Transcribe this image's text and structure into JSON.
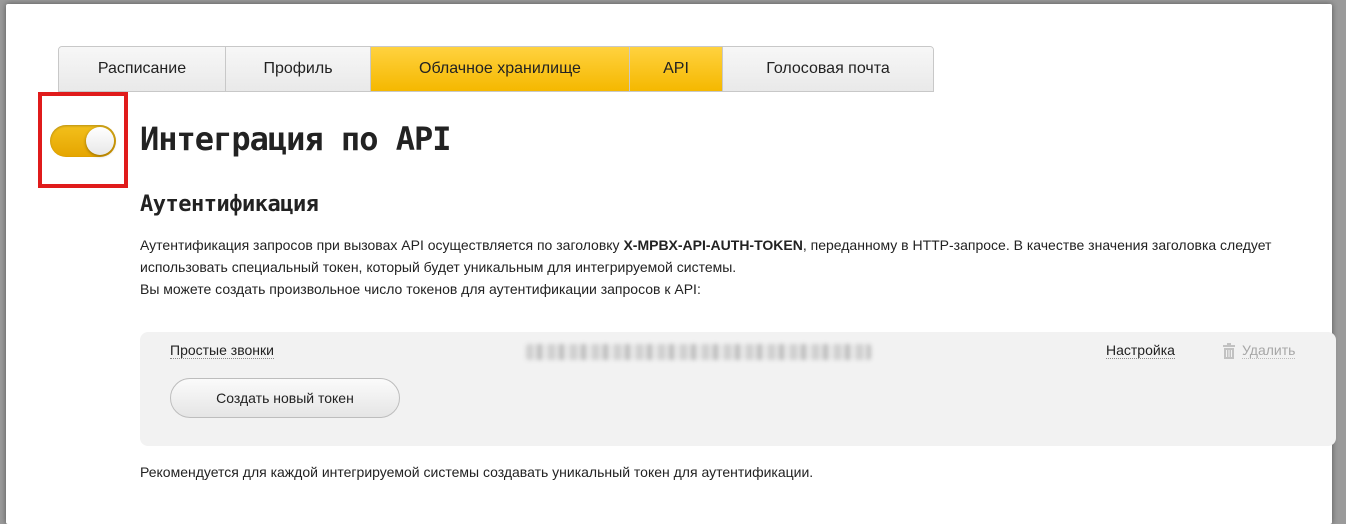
{
  "tabs": [
    {
      "label": "Расписание",
      "active": false
    },
    {
      "label": "Профиль",
      "active": false
    },
    {
      "label": "Облачное хранилище",
      "active": false
    },
    {
      "label": "API",
      "active": true
    },
    {
      "label": "Голосовая почта",
      "active": false
    }
  ],
  "toggle": {
    "state": "on"
  },
  "header": {
    "title": "Интеграция по API"
  },
  "auth": {
    "title": "Аутентификация",
    "para_part1": "Аутентификация запросов при вызовах API осуществляется по заголовку ",
    "token_header": "X-MPBX-API-AUTH-TOKEN",
    "para_part2": ", переданному в HTTP-запросе. В качестве значения заголовка следует использовать специальный токен, который будет уникальным для интегрируемой системы.",
    "para_line3": "Вы можете создать произвольное число токенов для аутентификации запросов к API:"
  },
  "tokens": [
    {
      "name": "Простые звонки",
      "settings_label": "Настройка",
      "delete_label": "Удалить"
    }
  ],
  "create_button": "Создать новый токен",
  "footer": {
    "note": "Рекомендуется для каждой интегрируемой системы создавать уникальный токен для аутентификации."
  },
  "colors": {
    "accent": "#f5b800",
    "highlight": "#e01b1b"
  }
}
